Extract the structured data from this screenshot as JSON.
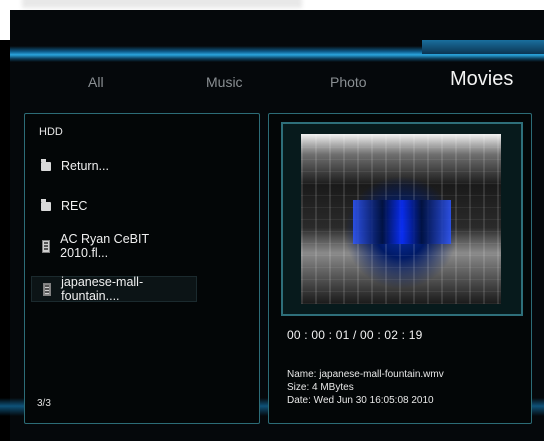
{
  "tabs": [
    {
      "label": "All"
    },
    {
      "label": "Music"
    },
    {
      "label": "Photo"
    },
    {
      "label": "Movies"
    }
  ],
  "left_panel": {
    "location": "HDD",
    "items": [
      {
        "label": "Return...",
        "icon": "folder-icon"
      },
      {
        "label": "REC",
        "icon": "folder-icon"
      },
      {
        "label": "AC Ryan CeBIT 2010.fl...",
        "icon": "video-file-icon"
      },
      {
        "label": "japanese-mall-fountain....",
        "icon": "video-file-icon"
      }
    ],
    "page_count": "3/3"
  },
  "right_panel": {
    "time": "00 : 00 : 01 / 00 : 02 : 19",
    "info": {
      "name": "Name: japanese-mall-fountain.wmv",
      "size": "Size: 4 MBytes",
      "date": "Date: Wed Jun 30 16:05:08 2010"
    }
  },
  "colors": {
    "accent_blue": "#2aa4dc",
    "panel_border": "#2c6c77"
  }
}
